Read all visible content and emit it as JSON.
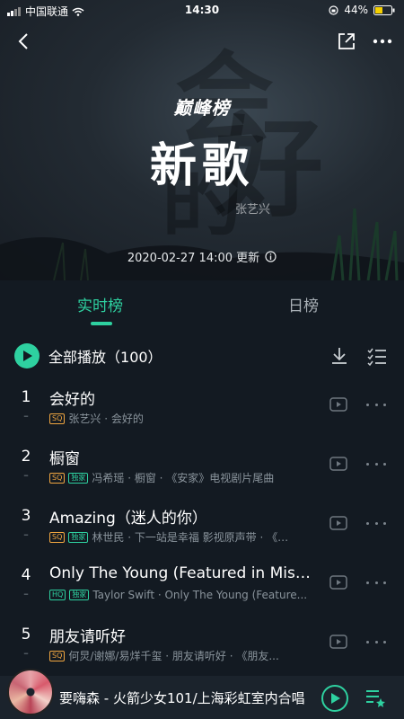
{
  "status_bar": {
    "carrier": "中国联通",
    "time": "14:30",
    "battery": "44%"
  },
  "hero": {
    "logo": "巅峰榜",
    "title": "新歌",
    "artist_watermark": "张艺兴",
    "updated": "2020-02-27  14:00 更新"
  },
  "tabs": [
    {
      "label": "实时榜",
      "active": true
    },
    {
      "label": "日榜",
      "active": false
    }
  ],
  "play_all": {
    "label": "全部播放",
    "count": "（100）"
  },
  "songs": [
    {
      "rank": "1",
      "change": "–",
      "title": "会好的",
      "badges": [
        "SQ"
      ],
      "meta": "张艺兴 · 会好的"
    },
    {
      "rank": "2",
      "change": "–",
      "title": "橱窗",
      "badges": [
        "SQ",
        "独家"
      ],
      "meta": "冯希瑶 · 橱窗 · 《安家》电视剧片尾曲"
    },
    {
      "rank": "3",
      "change": "–",
      "title": "Amazing（迷人的你）",
      "badges": [
        "SQ",
        "独家"
      ],
      "meta": "林世民 · 下一站是幸福 影视原声带 · 《…"
    },
    {
      "rank": "4",
      "change": "–",
      "title": "Only The Young (Featured in Miss A...",
      "badges": [
        "HQ",
        "独家"
      ],
      "meta": "Taylor Swift · Only The Young (Feature..."
    },
    {
      "rank": "5",
      "change": "–",
      "title": "朋友请听好",
      "badges": [
        "SQ"
      ],
      "meta": "何炅/谢娜/易烊千玺 · 朋友请听好 · 《朋友..."
    }
  ],
  "now_playing": {
    "text": "要嗨森 - 火箭少女101/上海彩虹室内合唱"
  },
  "colors": {
    "accent": "#2ed1a0",
    "sq_badge": "#f0a640",
    "background": "#131a22"
  }
}
